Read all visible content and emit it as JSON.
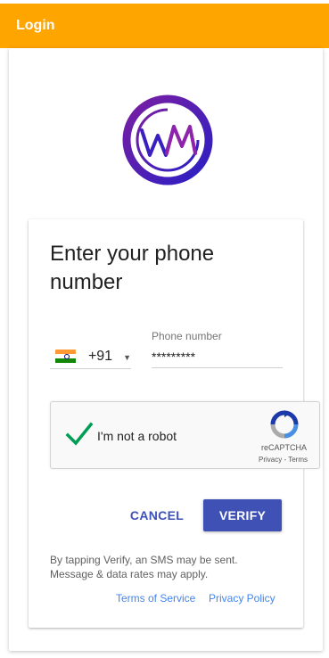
{
  "appbar": {
    "title": "Login"
  },
  "logo": {
    "icon": "wm-logo-icon",
    "text": "WM",
    "colors": [
      "#7B1FA2",
      "#2A1FC4"
    ]
  },
  "form": {
    "heading": "Enter your phone number",
    "country": {
      "flag": "india-flag-icon",
      "dial_code": "+91"
    },
    "phone": {
      "label": "Phone number",
      "value": "*********"
    }
  },
  "recaptcha": {
    "checked": true,
    "label": "I'm not a robot",
    "brand": "reCAPTCHA",
    "privacy": "Privacy",
    "separator": "-",
    "terms": "Terms"
  },
  "actions": {
    "cancel_label": "CANCEL",
    "verify_label": "VERIFY"
  },
  "note": {
    "sms_text": "By tapping Verify, an SMS may be sent. Message & data rates may apply."
  },
  "links": {
    "terms_of_service": "Terms of Service",
    "privacy_policy": "Privacy Policy"
  },
  "colors": {
    "appbar": "#FFA500",
    "primary": "#3F51B5",
    "link": "#4285F4",
    "check": "#009E55"
  }
}
